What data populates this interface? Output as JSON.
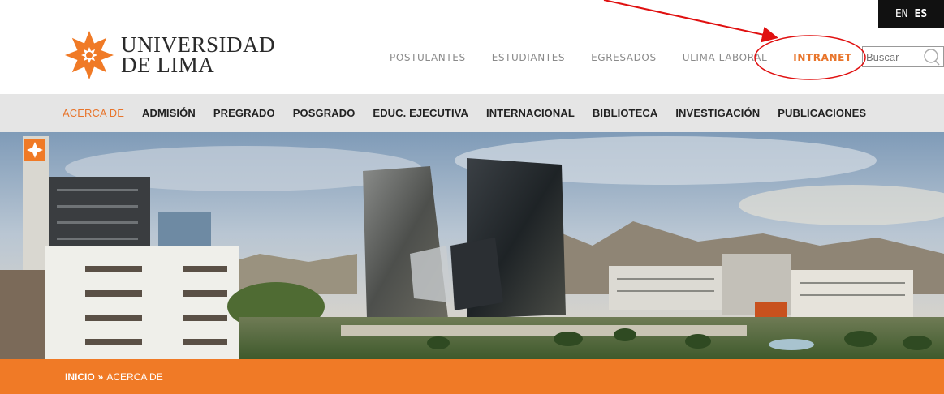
{
  "language": {
    "en": "EN",
    "es": "ES"
  },
  "logo": {
    "line1": "UNIVERSIDAD",
    "line2": "DE LIMA",
    "icon": "star-flower-logo",
    "color": "#f07a26"
  },
  "topnav": [
    {
      "label": "POSTULANTES"
    },
    {
      "label": "ESTUDIANTES"
    },
    {
      "label": "EGRESADOS"
    },
    {
      "label": "ULIMA LABORAL"
    },
    {
      "label": "INTRANET"
    }
  ],
  "search": {
    "placeholder": "Buscar",
    "icon": "search-icon"
  },
  "mainnav": [
    {
      "label": "ACERCA DE"
    },
    {
      "label": "ADMISIÓN"
    },
    {
      "label": "PREGRADO"
    },
    {
      "label": "POSGRADO"
    },
    {
      "label": "EDUC. EJECUTIVA"
    },
    {
      "label": "INTERNACIONAL"
    },
    {
      "label": "BIBLIOTECA"
    },
    {
      "label": "INVESTIGACIÓN"
    },
    {
      "label": "PUBLICACIONES"
    }
  ],
  "breadcrumb": {
    "home": "INICIO",
    "separator": "»",
    "current": "ACERCA DE"
  },
  "colors": {
    "accent": "#f07a26",
    "annotation": "#e01010",
    "nav_bg": "#e5e5e5"
  }
}
